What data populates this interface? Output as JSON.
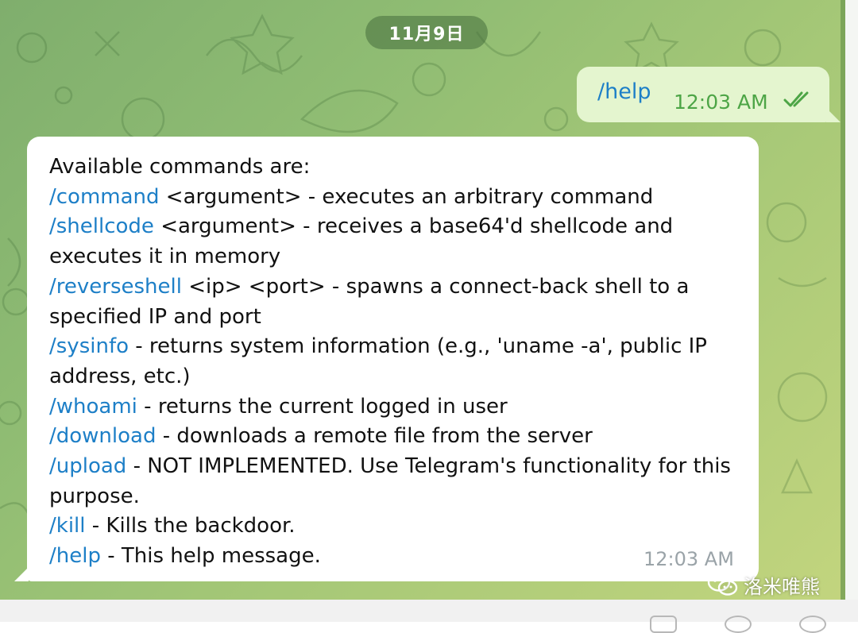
{
  "date_label": "11月9日",
  "outgoing": {
    "text": "/help",
    "time": "12:03 AM",
    "status_icon": "double-check-icon"
  },
  "incoming": {
    "lines": [
      [
        {
          "t": "Available commands are:",
          "c": false
        }
      ],
      [
        {
          "t": "/command",
          "c": true
        },
        {
          "t": " <argument> - executes an arbitrary command",
          "c": false
        }
      ],
      [
        {
          "t": "/shellcode",
          "c": true
        },
        {
          "t": " <argument> - receives a base64'd shellcode and",
          "c": false
        }
      ],
      [
        {
          "t": "executes it in memory",
          "c": false
        }
      ],
      [
        {
          "t": "/reverseshell",
          "c": true
        },
        {
          "t": " <ip> <port> - spawns a connect-back shell to a",
          "c": false
        }
      ],
      [
        {
          "t": "specified IP and port",
          "c": false
        }
      ],
      [
        {
          "t": "/sysinfo",
          "c": true
        },
        {
          "t": " - returns system information (e.g., 'uname -a', public IP",
          "c": false
        }
      ],
      [
        {
          "t": "address, etc.)",
          "c": false
        }
      ],
      [
        {
          "t": "/whoami",
          "c": true
        },
        {
          "t": " - returns the current logged in user",
          "c": false
        }
      ],
      [
        {
          "t": "/download",
          "c": true
        },
        {
          "t": " - downloads a remote file from the server",
          "c": false
        }
      ],
      [
        {
          "t": "/upload",
          "c": true
        },
        {
          "t": " - NOT IMPLEMENTED. Use Telegram's functionality for this",
          "c": false
        }
      ],
      [
        {
          "t": "purpose.",
          "c": false
        }
      ],
      [
        {
          "t": "/kill",
          "c": true
        },
        {
          "t": " - Kills the backdoor.",
          "c": false
        }
      ],
      [
        {
          "t": "/help",
          "c": true
        },
        {
          "t": " - This help message.",
          "c": false
        }
      ]
    ],
    "time": "12:03 AM"
  },
  "watermark": {
    "text": "洛米唯熊",
    "icon": "wechat-icon"
  },
  "colors": {
    "background": "#8fbc73",
    "outgoing_bubble": "#e4f5cf",
    "incoming_bubble": "#ffffff",
    "link": "#1d7fc7",
    "outgoing_time": "#4da546",
    "incoming_time": "#9aa3a8"
  }
}
